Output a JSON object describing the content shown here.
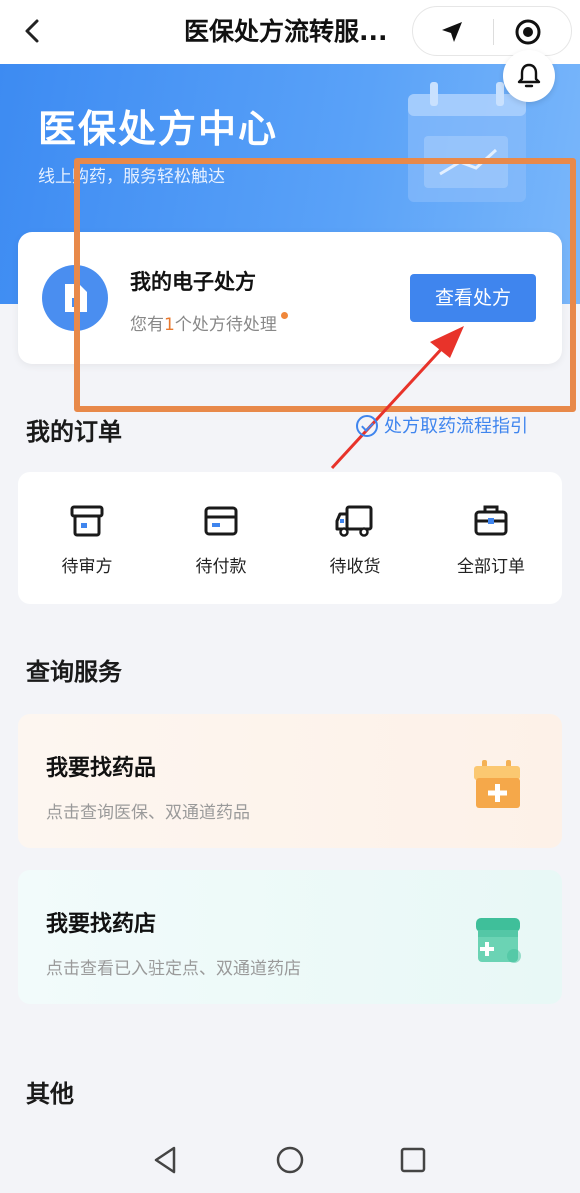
{
  "navbar": {
    "back_icon": "chevron-left-icon",
    "title": "医保处方流转服...",
    "locate_icon": "location-arrow-icon",
    "target_icon": "record-target-icon"
  },
  "hero": {
    "title": "医保处方中心",
    "subtitle": "线上购药，服务轻松触达",
    "bell_icon": "bell-icon",
    "accent": "#3d8bf2"
  },
  "prescription": {
    "title": "我的电子处方",
    "sub_prefix": "您有",
    "count": "1",
    "sub_suffix": "个处方待处理",
    "button_label": "查看处方",
    "count_color": "#e8792f"
  },
  "orders": {
    "title": "我的订单",
    "guide_link": "处方取药流程指引",
    "items": [
      {
        "label": "待审方",
        "icon": "pending-review-icon"
      },
      {
        "label": "待付款",
        "icon": "pending-payment-icon"
      },
      {
        "label": "待收货",
        "icon": "delivery-truck-icon"
      },
      {
        "label": "全部订单",
        "icon": "briefcase-icon"
      }
    ]
  },
  "query": {
    "title": "查询服务",
    "drug": {
      "title": "我要找药品",
      "subtitle": "点击查询医保、双通道药品",
      "icon": "medicine-box-icon"
    },
    "store": {
      "title": "我要找药店",
      "subtitle": "点击查看已入驻定点、双通道药店",
      "icon": "pharmacy-store-icon"
    }
  },
  "other": {
    "title": "其他"
  },
  "system_nav": {
    "back": "triangle-back-icon",
    "home": "circle-home-icon",
    "recent": "square-recent-icon"
  }
}
